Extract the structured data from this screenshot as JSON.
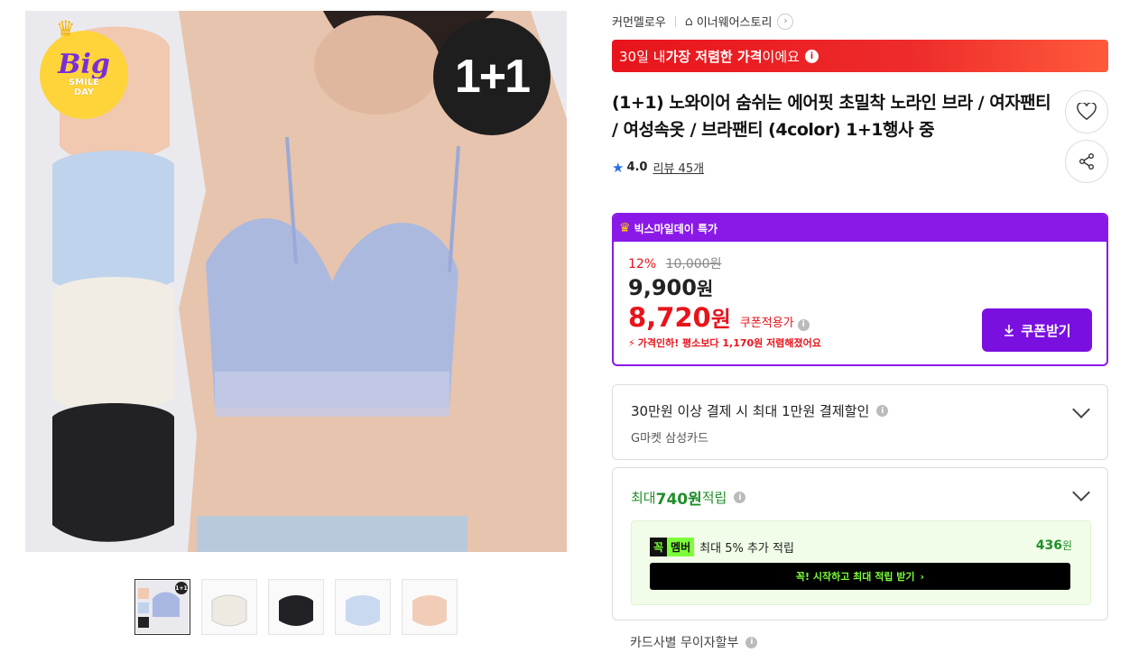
{
  "gallery": {
    "badge_plus": "1+1",
    "promo_badge": {
      "big": "Big",
      "line1": "SMILE",
      "line2": "DAY"
    },
    "thumbnail_badge": "1+1",
    "thumbnails": [
      "thumb-set",
      "thumb-white",
      "thumb-black",
      "thumb-blue",
      "thumb-peach"
    ]
  },
  "breadcrumb": {
    "store": "커먼멜로우",
    "category": "이너웨어스토리"
  },
  "lowest_price_banner": {
    "prefix": "30일 내 ",
    "bold": "가장 저렴한 가격",
    "suffix": "이에요"
  },
  "product": {
    "title": "(1+1) 노와이어 숨쉬는 에어핏 초밀착 노라인 브라 / 여자팬티 / 여성속옷 / 브라팬티 (4color) 1+1행사 중",
    "rating": "4.0",
    "review_label": "리뷰",
    "review_count": "45개"
  },
  "deal": {
    "header": "빅스마일데이 특가",
    "discount_pct": "12%",
    "original_price": "10,000원",
    "price_value": "9,900",
    "price_unit": "원",
    "coupon_price_value": "8,720",
    "coupon_price_unit": "원",
    "coupon_apply_label": "쿠폰적용가",
    "price_drop_text": "가격인하! 평소보다 1,170원 저렴해졌어요",
    "coupon_button": "쿠폰받기"
  },
  "card_discount": {
    "title": "30만원 이상 결제 시 최대 1만원 결제할인",
    "subtitle": "G마켓 삼성카드"
  },
  "points": {
    "prefix": "최대 ",
    "amount": "740원",
    "suffix": " 적립",
    "member_tag_a": "꼭",
    "member_tag_b": "멤버",
    "member_text": "최대 5% 추가 적립",
    "member_amount": "436",
    "member_unit": "원",
    "cta": "꼭! 시작하고 최대 적립 받기"
  },
  "installment": {
    "label": "카드사별 무이자할부"
  },
  "colors": {
    "accent_red": "#e8141c",
    "accent_purple": "#8a19e8",
    "points_green": "#1f8f2a",
    "member_lime": "#7dff3a",
    "star_blue": "#2b6de8"
  }
}
